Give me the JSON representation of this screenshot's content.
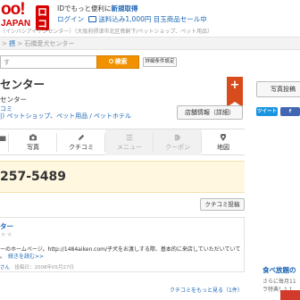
{
  "logo": {
    "top": "oo!",
    "sub": "JAPAN",
    "badge": "ロコ"
  },
  "header": {
    "promo1_prefix": "IDでもっと便利に",
    "promo1_link": "新規取得",
    "login": "ログイン",
    "cart_text": "送料込み1,000円 目玉商品セール中"
  },
  "address_line": "（イシバシアイケンセンター）（大阪府摂津市北区鳥飼下/ペットショップ、ペット用品）",
  "breadcrumb": {
    "sep1": "> ",
    "item1": "摂",
    "sep2": " > ",
    "item2": "石橋愛犬センター"
  },
  "search": {
    "placeholder": "す",
    "button": "検索",
    "detail": "詳細条件設定"
  },
  "store": {
    "title": "センター",
    "subtitle": "センター",
    "kuchikomi": "コミ",
    "category": "|) ペットショップ、ペット用品 / ペットホテル",
    "info_button": "店舗情報（詳細）",
    "phone": "257-5489"
  },
  "side": {
    "photo_button": "写真投稿",
    "tweet": "ツイート",
    "fb": "f"
  },
  "tabs": [
    {
      "label": "写真"
    },
    {
      "label": "クチコミ"
    },
    {
      "label": "メニュー"
    },
    {
      "label": "クーポン"
    },
    {
      "label": "地図"
    }
  ],
  "kuchikomi_post_button": "クチコミ投稿",
  "review": {
    "title": "ター",
    "stars": "★★",
    "text": "ーのホームページ。http://1484aiken.com/子犬をお渡しする際、基本的に来店していただいていて",
    "text_more": "続きを読む>>",
    "text_prefix": "。",
    "user": "さん",
    "date": "投稿日：2008年05月27日"
  },
  "kuchikomi_more": "クチコミをもっと見る（1件）",
  "side_promo": {
    "title": "食べ放題の",
    "text1": "さらに毎月11",
    "text2": "ラ特典！1,1"
  },
  "colors": {
    "accent": "#f29100",
    "link": "#1a64b5",
    "brand": "#d60000",
    "bookmark": "#d84b1d"
  }
}
